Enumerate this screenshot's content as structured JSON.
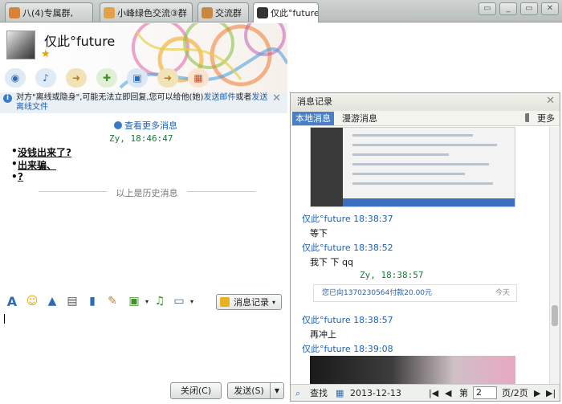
{
  "tabs": [
    {
      "label": "八(4)专属群,"
    },
    {
      "label": "小峰绿色交流③群"
    },
    {
      "label": "交流群"
    },
    {
      "label": "仅此°future"
    }
  ],
  "window": {
    "minimize": "▭",
    "maximize": "▭",
    "close": "✕"
  },
  "contact": {
    "name": "仅此°future"
  },
  "notice": {
    "text1": "对方\"离线或隐身\",可能无法立即回复,您可以给他(她)",
    "link1": "发送邮件",
    "text2": "或者",
    "link2": "发送离线文件"
  },
  "chat": {
    "more_link": "查看更多消息",
    "header": "Zy,  18:46:47",
    "history": [
      "没钱出来了?",
      "出来骗、",
      "?"
    ],
    "divider": "以上是历史消息"
  },
  "toolbar_bottom": {
    "msg_record": "消息记录"
  },
  "buttons": {
    "close": "关闭(C)",
    "send": "发送(S)"
  },
  "record": {
    "title": "消息记录",
    "tabs": [
      "本地消息",
      "漫游消息"
    ],
    "more": "更多",
    "messages": [
      {
        "sender": "仅此°future 18:38:37",
        "body": "等下"
      },
      {
        "sender": "仅此°future 18:38:52",
        "body": "我下  下 qq"
      },
      {
        "sender": "Zy,  18:38:57",
        "body": ""
      },
      {
        "sender": "仅此°future 18:38:57",
        "body": "再冲上"
      },
      {
        "sender": "仅此°future 18:39:08",
        "body": ""
      }
    ],
    "card_text": "您已向1370230564付款20.00元",
    "card_time": "今天",
    "find": "查找",
    "date": "2013-12-13",
    "page_prefix": "第",
    "page_value": "2",
    "page_suffix": "页/2页"
  }
}
